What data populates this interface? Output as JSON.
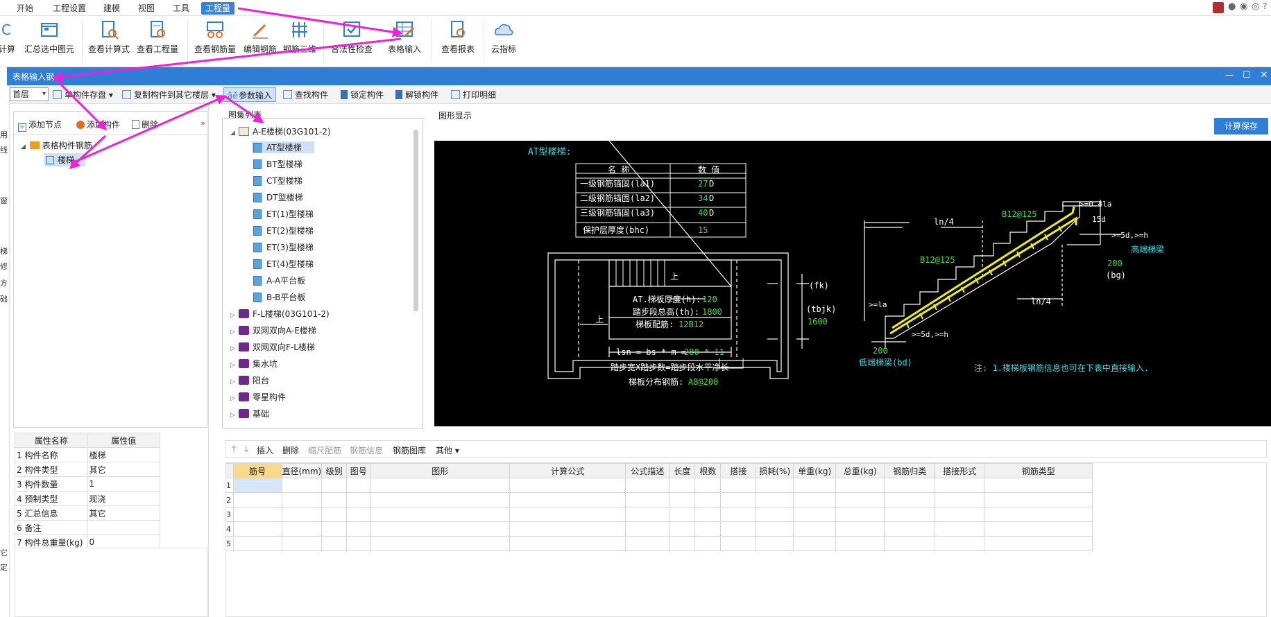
{
  "menubar": {
    "items": [
      "开始",
      "工程设置",
      "建模",
      "视图",
      "工具",
      "工程量"
    ],
    "active_index": 5
  },
  "ribbon": {
    "buttons": [
      "计算",
      "汇总选中图元",
      "查看计算式",
      "查看工程量",
      "查看钢筋量",
      "编辑钢筋",
      "钢筋三维",
      "合法性检查",
      "表格输入",
      "查看报表",
      "云指标"
    ]
  },
  "window": {
    "title": "表格输入钢",
    "controls": [
      "—",
      "☐",
      "✕"
    ]
  },
  "left_strip": [
    "用",
    "线",
    "窗",
    "梯",
    "修",
    "方",
    "础",
    "它",
    "定"
  ],
  "toolbar2": {
    "floor_value": "首层",
    "save_component": "单构件存盘",
    "copy_to_floor": "复制构件到其它楼层",
    "param_input": "参数输入",
    "find_component": "查找构件",
    "lock_component": "锁定构件",
    "unlock_component": "解锁构件",
    "print_detail": "打印明细"
  },
  "left_tree_toolbar": {
    "add_node": "添加节点",
    "add_component": "添加构件",
    "delete": "删除"
  },
  "left_tree": {
    "root": "表格构件钢筋",
    "child": "楼梯"
  },
  "atlas": {
    "heading": "图集列表",
    "items": [
      {
        "label": "A-E楼梯(03G101-2)",
        "type": "book-open",
        "expanded": true
      },
      {
        "label": "AT型楼梯",
        "type": "doc",
        "selected": true
      },
      {
        "label": "BT型楼梯",
        "type": "doc"
      },
      {
        "label": "CT型楼梯",
        "type": "doc"
      },
      {
        "label": "DT型楼梯",
        "type": "doc"
      },
      {
        "label": "ET(1)型楼梯",
        "type": "doc"
      },
      {
        "label": "ET(2)型楼梯",
        "type": "doc"
      },
      {
        "label": "ET(3)型楼梯",
        "type": "doc"
      },
      {
        "label": "ET(4)型楼梯",
        "type": "doc"
      },
      {
        "label": "A-A平台板",
        "type": "doc"
      },
      {
        "label": "B-B平台板",
        "type": "doc"
      },
      {
        "label": "F-L楼梯(03G101-2)",
        "type": "book"
      },
      {
        "label": "双网双向A-E楼梯",
        "type": "book"
      },
      {
        "label": "双网双向F-L楼梯",
        "type": "book"
      },
      {
        "label": "集水坑",
        "type": "book"
      },
      {
        "label": "阳台",
        "type": "book"
      },
      {
        "label": "零星构件",
        "type": "book"
      },
      {
        "label": "基础",
        "type": "book"
      }
    ]
  },
  "graph": {
    "heading": "图形显示",
    "calc_save": "计算保存",
    "title": "AT型楼梯:",
    "param_table": {
      "headers": [
        "名  称",
        "数  值"
      ],
      "rows": [
        {
          "name": "一级钢筋锚固(la1)",
          "value": "27",
          "unit": "D"
        },
        {
          "name": "二级钢筋锚固(la2)",
          "value": "34",
          "unit": "D"
        },
        {
          "name": "三级钢筋锚固(la3)",
          "value": "40",
          "unit": "D"
        },
        {
          "name": "保护层厚度(bhc)",
          "value": "15",
          "unit": ""
        }
      ]
    },
    "plan_labels": {
      "thickness": "AT.梯板厚度(h):",
      "thickness_val": "120",
      "total_height": "踏步段总高(th):",
      "total_height_val": "1800",
      "main_rebar": "梯板配筋:",
      "main_rebar_val": "12B12",
      "fk": "(fk)",
      "tbjk": "(tbjk)",
      "tbjk_val": "1600",
      "up1": "上",
      "up2": "上",
      "lsn_a": "lsn = bs * m =",
      "lsn_b": "280 * 11",
      "step_note": "踏步宽X踏步数=踏步段水平净长",
      "dist_rebar": "梯板分布钢筋:",
      "dist_rebar_val": "A8@200"
    },
    "section_labels": {
      "ln4_top": "ln/4",
      "ln4_bottom": "ln/4",
      "b12_top": "B12@125",
      "b12_left": "B12@125",
      "d04": ">=0.4la",
      "d15": "15d",
      "d5h_top": ">=5d,>=h",
      "high_beam": "高端梯梁",
      "bg_val": "200",
      "bg": "(bg)",
      "la": ">=la",
      "d5h_bottom": ">=5d,>=h",
      "bd_val": "200",
      "low_beam": "低端梯梁(bd)",
      "note": "注: 1.楼梯板钢筋信息也可在下表中直接输入."
    }
  },
  "props": {
    "headers": [
      "属性名称",
      "属性值"
    ],
    "rows": [
      [
        "1 构件名称",
        "楼梯"
      ],
      [
        "2 构件类型",
        "其它"
      ],
      [
        "3 构件数量",
        "1"
      ],
      [
        "4 预制类型",
        "现浇"
      ],
      [
        "5 汇总信息",
        "其它"
      ],
      [
        "6 备注",
        ""
      ],
      [
        "7 构件总重量(kg)",
        "0"
      ]
    ]
  },
  "rebar_toolbar": {
    "up": "↑",
    "down": "↓",
    "insert": "插入",
    "delete": "删除",
    "scale": "缩尺配筋",
    "info": "钢筋信息",
    "library": "钢筋图库",
    "other": "其他"
  },
  "rebar_table": {
    "headers": [
      "筋号",
      "直径(mm)",
      "级别",
      "图号",
      "图形",
      "计算公式",
      "公式描述",
      "长度",
      "根数",
      "搭接",
      "损耗(%)",
      "单重(kg)",
      "总重(kg)",
      "钢筋归类",
      "搭接形式",
      "钢筋类型"
    ],
    "row_numbers": [
      "1",
      "2",
      "3",
      "4",
      "5"
    ]
  },
  "colors": {
    "accent": "#2f7fd6",
    "arrow": "#f020d8",
    "cad_bg": "#000000",
    "cad_text": "#ffffff",
    "cad_cyan": "#33ddee",
    "cad_green": "#40e040",
    "cad_yellow": "#f0f000"
  }
}
